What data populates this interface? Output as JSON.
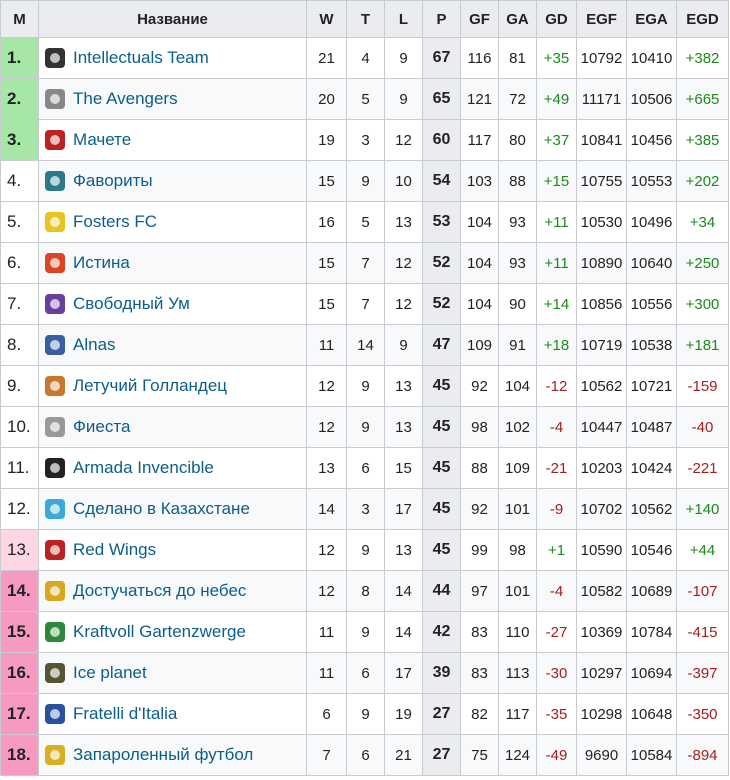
{
  "headers": {
    "m": "М",
    "name": "Название",
    "w": "W",
    "t": "T",
    "l": "L",
    "p": "P",
    "gf": "GF",
    "ga": "GA",
    "gd": "GD",
    "egf": "EGF",
    "ega": "EGA",
    "egd": "EGD"
  },
  "rows": [
    {
      "pos": "1.",
      "zone": "green",
      "name": "Intellectuals Team",
      "icon": "intellectuals-team-logo-icon",
      "w": "21",
      "t": "4",
      "l": "9",
      "p": "67",
      "gf": "116",
      "ga": "81",
      "gd": "+35",
      "egf": "10792",
      "ega": "10410",
      "egd": "+382"
    },
    {
      "pos": "2.",
      "zone": "green",
      "name": "The Avengers",
      "icon": "avengers-logo-icon",
      "w": "20",
      "t": "5",
      "l": "9",
      "p": "65",
      "gf": "121",
      "ga": "72",
      "gd": "+49",
      "egf": "11171",
      "ega": "10506",
      "egd": "+665"
    },
    {
      "pos": "3.",
      "zone": "green",
      "name": "Мачете",
      "icon": "machete-logo-icon",
      "w": "19",
      "t": "3",
      "l": "12",
      "p": "60",
      "gf": "117",
      "ga": "80",
      "gd": "+37",
      "egf": "10841",
      "ega": "10456",
      "egd": "+385"
    },
    {
      "pos": "4.",
      "zone": "",
      "name": "Фавориты",
      "icon": "favority-logo-icon",
      "w": "15",
      "t": "9",
      "l": "10",
      "p": "54",
      "gf": "103",
      "ga": "88",
      "gd": "+15",
      "egf": "10755",
      "ega": "10553",
      "egd": "+202"
    },
    {
      "pos": "5.",
      "zone": "",
      "name": "Fosters FC",
      "icon": "fosters-fc-logo-icon",
      "w": "16",
      "t": "5",
      "l": "13",
      "p": "53",
      "gf": "104",
      "ga": "93",
      "gd": "+11",
      "egf": "10530",
      "ega": "10496",
      "egd": "+34"
    },
    {
      "pos": "6.",
      "zone": "",
      "name": "Истина",
      "icon": "truth-logo-icon",
      "w": "15",
      "t": "7",
      "l": "12",
      "p": "52",
      "gf": "104",
      "ga": "93",
      "gd": "+11",
      "egf": "10890",
      "ega": "10640",
      "egd": "+250"
    },
    {
      "pos": "7.",
      "zone": "",
      "name": "Свободный Ум",
      "icon": "free-mind-logo-icon",
      "w": "15",
      "t": "7",
      "l": "12",
      "p": "52",
      "gf": "104",
      "ga": "90",
      "gd": "+14",
      "egf": "10856",
      "ega": "10556",
      "egd": "+300"
    },
    {
      "pos": "8.",
      "zone": "",
      "name": "Alnas",
      "icon": "alnas-logo-icon",
      "w": "11",
      "t": "14",
      "l": "9",
      "p": "47",
      "gf": "109",
      "ga": "91",
      "gd": "+18",
      "egf": "10719",
      "ega": "10538",
      "egd": "+181"
    },
    {
      "pos": "9.",
      "zone": "",
      "name": "Летучий Голландец",
      "icon": "flying-dutchman-logo-icon",
      "w": "12",
      "t": "9",
      "l": "13",
      "p": "45",
      "gf": "92",
      "ga": "104",
      "gd": "-12",
      "egf": "10562",
      "ega": "10721",
      "egd": "-159"
    },
    {
      "pos": "10.",
      "zone": "",
      "name": "Фиеста",
      "icon": "fiesta-logo-icon",
      "w": "12",
      "t": "9",
      "l": "13",
      "p": "45",
      "gf": "98",
      "ga": "102",
      "gd": "-4",
      "egf": "10447",
      "ega": "10487",
      "egd": "-40"
    },
    {
      "pos": "11.",
      "zone": "",
      "name": "Armada Invencible",
      "icon": "armada-logo-icon",
      "w": "13",
      "t": "6",
      "l": "15",
      "p": "45",
      "gf": "88",
      "ga": "109",
      "gd": "-21",
      "egf": "10203",
      "ega": "10424",
      "egd": "-221"
    },
    {
      "pos": "12.",
      "zone": "",
      "name": "Сделано в Казахстане",
      "icon": "kazakhstan-flag-icon",
      "w": "14",
      "t": "3",
      "l": "17",
      "p": "45",
      "gf": "92",
      "ga": "101",
      "gd": "-9",
      "egf": "10702",
      "ega": "10562",
      "egd": "+140"
    },
    {
      "pos": "13.",
      "zone": "pink1",
      "name": "Red Wings",
      "icon": "red-wings-logo-icon",
      "w": "12",
      "t": "9",
      "l": "13",
      "p": "45",
      "gf": "99",
      "ga": "98",
      "gd": "+1",
      "egf": "10590",
      "ega": "10546",
      "egd": "+44"
    },
    {
      "pos": "14.",
      "zone": "pink2",
      "name": "Достучаться до небес",
      "icon": "knockin-heaven-logo-icon",
      "w": "12",
      "t": "8",
      "l": "14",
      "p": "44",
      "gf": "97",
      "ga": "101",
      "gd": "-4",
      "egf": "10582",
      "ega": "10689",
      "egd": "-107"
    },
    {
      "pos": "15.",
      "zone": "pink2",
      "name": "Kraftvoll Gartenzwerge",
      "icon": "garden-gnome-logo-icon",
      "w": "11",
      "t": "9",
      "l": "14",
      "p": "42",
      "gf": "83",
      "ga": "110",
      "gd": "-27",
      "egf": "10369",
      "ega": "10784",
      "egd": "-415"
    },
    {
      "pos": "16.",
      "zone": "pink2",
      "name": "Ice planet",
      "icon": "ice-planet-logo-icon",
      "w": "11",
      "t": "6",
      "l": "17",
      "p": "39",
      "gf": "83",
      "ga": "113",
      "gd": "-30",
      "egf": "10297",
      "ega": "10694",
      "egd": "-397"
    },
    {
      "pos": "17.",
      "zone": "pink2",
      "name": "Fratelli d'Italia",
      "icon": "fratelli-italia-logo-icon",
      "w": "6",
      "t": "9",
      "l": "19",
      "p": "27",
      "gf": "82",
      "ga": "117",
      "gd": "-35",
      "egf": "10298",
      "ega": "10648",
      "egd": "-350"
    },
    {
      "pos": "18.",
      "zone": "pink2",
      "name": "Запароленный футбол",
      "icon": "password-football-logo-icon",
      "w": "7",
      "t": "6",
      "l": "21",
      "p": "27",
      "gf": "75",
      "ga": "124",
      "gd": "-49",
      "egf": "9690",
      "ega": "10584",
      "egd": "-894"
    }
  ],
  "colors": {
    "green_zone": "#a6e6a6",
    "pink_light": "#ffd6e4",
    "pink_strong": "#f79ac2",
    "positive": "#1d8a1d",
    "negative": "#a51d1d",
    "link": "#0b5e8a"
  }
}
